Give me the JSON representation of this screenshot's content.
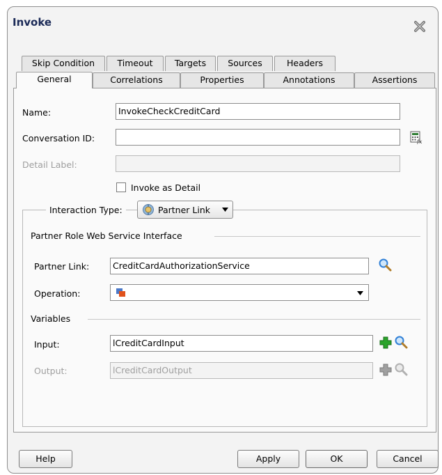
{
  "dialog": {
    "title": "Invoke",
    "tabs_row1": [
      {
        "label": "Skip Condition"
      },
      {
        "label": "Timeout"
      },
      {
        "label": "Targets"
      },
      {
        "label": "Sources"
      },
      {
        "label": "Headers"
      }
    ],
    "tabs_row2": [
      {
        "label": "General"
      },
      {
        "label": "Correlations"
      },
      {
        "label": "Properties"
      },
      {
        "label": "Annotations"
      },
      {
        "label": "Assertions"
      }
    ],
    "active_tab": "General"
  },
  "form": {
    "name_label": "Name:",
    "name_value": "InvokeCheckCreditCard",
    "conversation_label": "Conversation ID:",
    "conversation_value": "",
    "detail_label": "Detail Label:",
    "detail_value": "",
    "invoke_detail_label": "Invoke as Detail",
    "invoke_detail_checked": false
  },
  "interaction": {
    "label": "Interaction Type:",
    "type_label": "Partner Link",
    "section_title": "Partner Role Web Service Interface",
    "partner_link_label": "Partner Link:",
    "partner_link_value": "CreditCardAuthorizationService",
    "operation_label": "Operation:",
    "operation_value": "",
    "variables_title": "Variables",
    "input_label": "Input:",
    "input_value": "lCreditCardInput",
    "output_label": "Output:",
    "output_value": "lCreditCardOutput"
  },
  "buttons": {
    "help": "Help",
    "apply": "Apply",
    "ok": "OK",
    "cancel": "Cancel"
  },
  "colors": {
    "title": "#1b2a57",
    "icon_blue": "#2f7fd6",
    "add_green": "#2aa32a"
  }
}
